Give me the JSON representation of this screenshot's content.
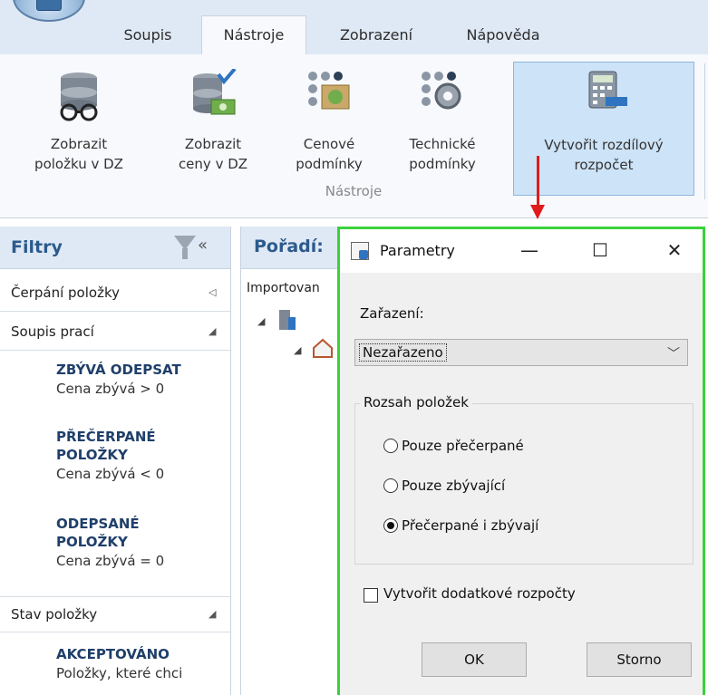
{
  "ribbon": {
    "tabs": [
      {
        "label": "Soupis",
        "active": false
      },
      {
        "label": "Nástroje",
        "active": true
      },
      {
        "label": "Zobrazení",
        "active": false
      },
      {
        "label": "Nápověda",
        "active": false
      }
    ],
    "buttons": [
      {
        "line1": "Zobrazit",
        "line2": "položku v DZ",
        "icon": "database-glasses-icon"
      },
      {
        "line1": "Zobrazit",
        "line2": "ceny v DZ",
        "icon": "database-money-icon"
      },
      {
        "line1": "Cenové",
        "line2": "podmínky",
        "icon": "price-conditions-icon"
      },
      {
        "line1": "Technické",
        "line2": "podmínky",
        "icon": "technical-conditions-icon"
      },
      {
        "line1": "Vytvořit rozdílový",
        "line2": "rozpočet",
        "icon": "calculator-icon"
      }
    ],
    "group_label": "Nástroje"
  },
  "filters": {
    "title": "Filtry",
    "collapse_glyph": "«",
    "rows": {
      "cerpani": "Čerpání položky",
      "soupis": "Soupis prací",
      "stav": "Stav položky"
    },
    "entries": [
      {
        "title": "ZBÝVÁ ODEPSAT",
        "sub": "Cena zbývá > 0"
      },
      {
        "title1": "PŘEČERPANÉ",
        "title2": "POLOŽKY",
        "sub": "Cena zbývá < 0"
      },
      {
        "title1": "ODEPSANÉ",
        "title2": "POLOŽKY",
        "sub": "Cena zbývá = 0"
      },
      {
        "title": "AKCEPTOVÁNO",
        "sub": "Položky, které chci"
      }
    ]
  },
  "order_panel": {
    "title": "Pořadí:",
    "column": "Importovan"
  },
  "dialog": {
    "title": "Parametry",
    "minimize": "—",
    "maximize": "☐",
    "close": "✕",
    "category_label": "Zařazení:",
    "category_value": "Nezařazeno",
    "range_caption": "Rozsah položek",
    "options": [
      {
        "label": "Pouze přečerpané",
        "checked": false
      },
      {
        "label": "Pouze zbývající",
        "checked": false
      },
      {
        "label": "Přečerpané i zbývají",
        "checked": true
      }
    ],
    "checkbox_label": "Vytvořit dodatkové rozpočty",
    "ok": "OK",
    "cancel": "Storno"
  },
  "colors": {
    "highlight_border": "#39d23a",
    "arrow": "#e01b1b",
    "header_blue": "#2c5a8c"
  }
}
